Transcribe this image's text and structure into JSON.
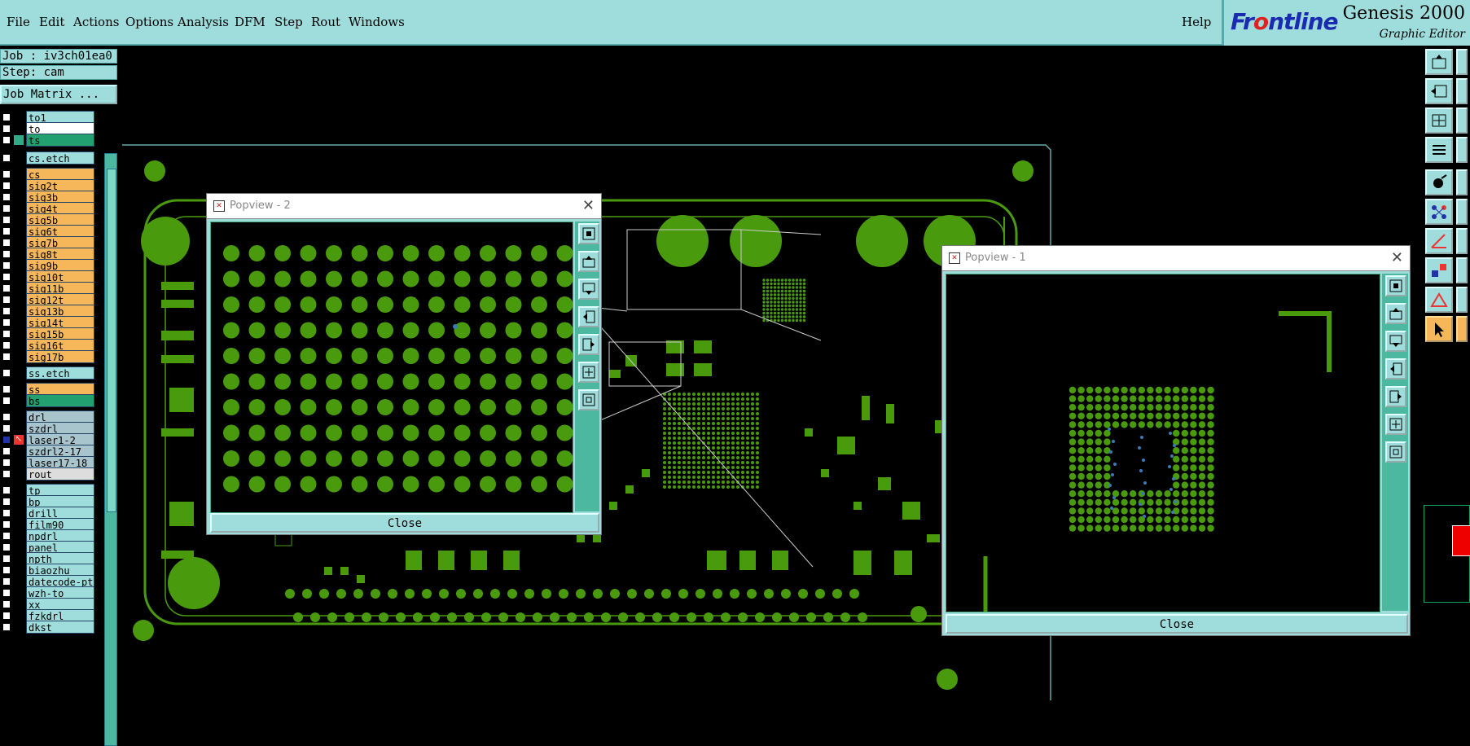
{
  "menubar": {
    "items": [
      "File",
      "Edit",
      "Actions",
      "Options",
      "Analysis",
      "DFM",
      "Step",
      "Rout",
      "Windows"
    ],
    "help": "Help"
  },
  "brand": {
    "logo_front": "Fr",
    "logo_accent": "o",
    "logo_tail": "ntline",
    "title": "Genesis 2000",
    "subtitle": "Graphic Editor"
  },
  "job": {
    "job_label": "Job : iv3ch01ea0",
    "step_label": "Step: cam",
    "matrix_button": "Job Matrix ..."
  },
  "layers": [
    {
      "name": "to1",
      "color": "#9fdcdc",
      "state": ""
    },
    {
      "name": "to",
      "color": "#ffffff",
      "state": ""
    },
    {
      "name": "ts",
      "color": "#22a070",
      "state": "green"
    },
    {
      "name": "cs.etch",
      "color": "#9fdcdc",
      "state": ""
    },
    {
      "name": "cs",
      "color": "#f5b75a",
      "state": ""
    },
    {
      "name": "sig2t",
      "color": "#f5b75a",
      "state": ""
    },
    {
      "name": "sig3b",
      "color": "#f5b75a",
      "state": ""
    },
    {
      "name": "sig4t",
      "color": "#f5b75a",
      "state": ""
    },
    {
      "name": "sig5b",
      "color": "#f5b75a",
      "state": ""
    },
    {
      "name": "sig6t",
      "color": "#f5b75a",
      "state": ""
    },
    {
      "name": "sig7b",
      "color": "#f5b75a",
      "state": ""
    },
    {
      "name": "sig8t",
      "color": "#f5b75a",
      "state": ""
    },
    {
      "name": "sig9b",
      "color": "#f5b75a",
      "state": ""
    },
    {
      "name": "sig10t",
      "color": "#f5b75a",
      "state": ""
    },
    {
      "name": "sig11b",
      "color": "#f5b75a",
      "state": ""
    },
    {
      "name": "sig12t",
      "color": "#f5b75a",
      "state": ""
    },
    {
      "name": "sig13b",
      "color": "#f5b75a",
      "state": ""
    },
    {
      "name": "sig14t",
      "color": "#f5b75a",
      "state": ""
    },
    {
      "name": "sig15b",
      "color": "#f5b75a",
      "state": ""
    },
    {
      "name": "sig16t",
      "color": "#f5b75a",
      "state": ""
    },
    {
      "name": "sig17b",
      "color": "#f5b75a",
      "state": ""
    },
    {
      "name": "ss.etch",
      "color": "#9fdcdc",
      "state": ""
    },
    {
      "name": "ss",
      "color": "#f5b75a",
      "state": ""
    },
    {
      "name": "bs",
      "color": "#22a070",
      "state": ""
    },
    {
      "name": "drl",
      "color": "#a8c4cc",
      "state": ""
    },
    {
      "name": "szdrl",
      "color": "#a8c4cc",
      "state": ""
    },
    {
      "name": "laser1-2",
      "color": "#a8c4cc",
      "state": "arrow",
      "checked": true
    },
    {
      "name": "szdrl2-17",
      "color": "#a8c4cc",
      "state": ""
    },
    {
      "name": "laser17-18",
      "color": "#a8c4cc",
      "state": ""
    },
    {
      "name": "rout",
      "color": "#dddddd",
      "state": ""
    },
    {
      "name": "tp",
      "color": "#9fdcdc",
      "state": ""
    },
    {
      "name": "bp",
      "color": "#9fdcdc",
      "state": ""
    },
    {
      "name": "drill",
      "color": "#9fdcdc",
      "state": ""
    },
    {
      "name": "film90",
      "color": "#9fdcdc",
      "state": ""
    },
    {
      "name": "npdrl",
      "color": "#9fdcdc",
      "state": ""
    },
    {
      "name": "panel",
      "color": "#9fdcdc",
      "state": ""
    },
    {
      "name": "npth",
      "color": "#9fdcdc",
      "state": ""
    },
    {
      "name": "biaozhu",
      "color": "#9fdcdc",
      "state": ""
    },
    {
      "name": "datecode-pt",
      "color": "#9fdcdc",
      "state": ""
    },
    {
      "name": "wzh-to",
      "color": "#9fdcdc",
      "state": ""
    },
    {
      "name": "xx",
      "color": "#9fdcdc",
      "state": ""
    },
    {
      "name": "fzkdrl",
      "color": "#9fdcdc",
      "state": ""
    },
    {
      "name": "dkst",
      "color": "#9fdcdc",
      "state": ""
    }
  ],
  "popview2": {
    "title": "Popview - 2",
    "close_label": "Close"
  },
  "popview1": {
    "title": "Popview - 1",
    "close_label": "Close"
  },
  "colors": {
    "panel": "#9fdcdc",
    "copper": "#4a9a0e",
    "accent_teal": "#4cb8a0",
    "layer_signal": "#f5b75a"
  }
}
